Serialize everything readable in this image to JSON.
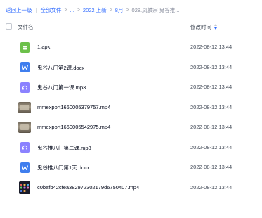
{
  "breadcrumb": {
    "back": "返回上一级",
    "items": [
      "全部文件",
      "...",
      "2022 上新",
      "8月"
    ],
    "current": "028.凤麟宗 鬼谷推..."
  },
  "header": {
    "name_label": "文件名",
    "time_label": "修改时间"
  },
  "files": [
    {
      "name": "1.apk",
      "time": "2022-08-12 13:44",
      "icon": "apk-file-icon"
    },
    {
      "name": "鬼谷八门第2课.docx",
      "time": "2022-08-12 13:44",
      "icon": "word-file-icon"
    },
    {
      "name": "鬼谷八门第一课.mp3",
      "time": "2022-08-12 13:44",
      "icon": "audio-file-icon"
    },
    {
      "name": "mmexport1660005379757.mp4",
      "time": "2022-08-12 13:44",
      "icon": "video-thumbnail-icon"
    },
    {
      "name": "mmexport1660005542975.mp4",
      "time": "2022-08-12 13:44",
      "icon": "video-thumbnail-icon"
    },
    {
      "name": "鬼谷推八门第二课.mp3",
      "time": "2022-08-12 13:44",
      "icon": "audio-file-icon"
    },
    {
      "name": "鬼谷推八门第1天.docx",
      "time": "2022-08-12 13:44",
      "icon": "word-file-icon"
    },
    {
      "name": "c0bafb42cfea382972302179d6750407.mp4",
      "time": "2022-08-12 13:44",
      "icon": "video-thumbnail-icon"
    }
  ],
  "colors": {
    "accent": "#2f6bff",
    "apk": "#6cc04a",
    "word": "#3f7eee",
    "audio": "#8b82ff"
  }
}
